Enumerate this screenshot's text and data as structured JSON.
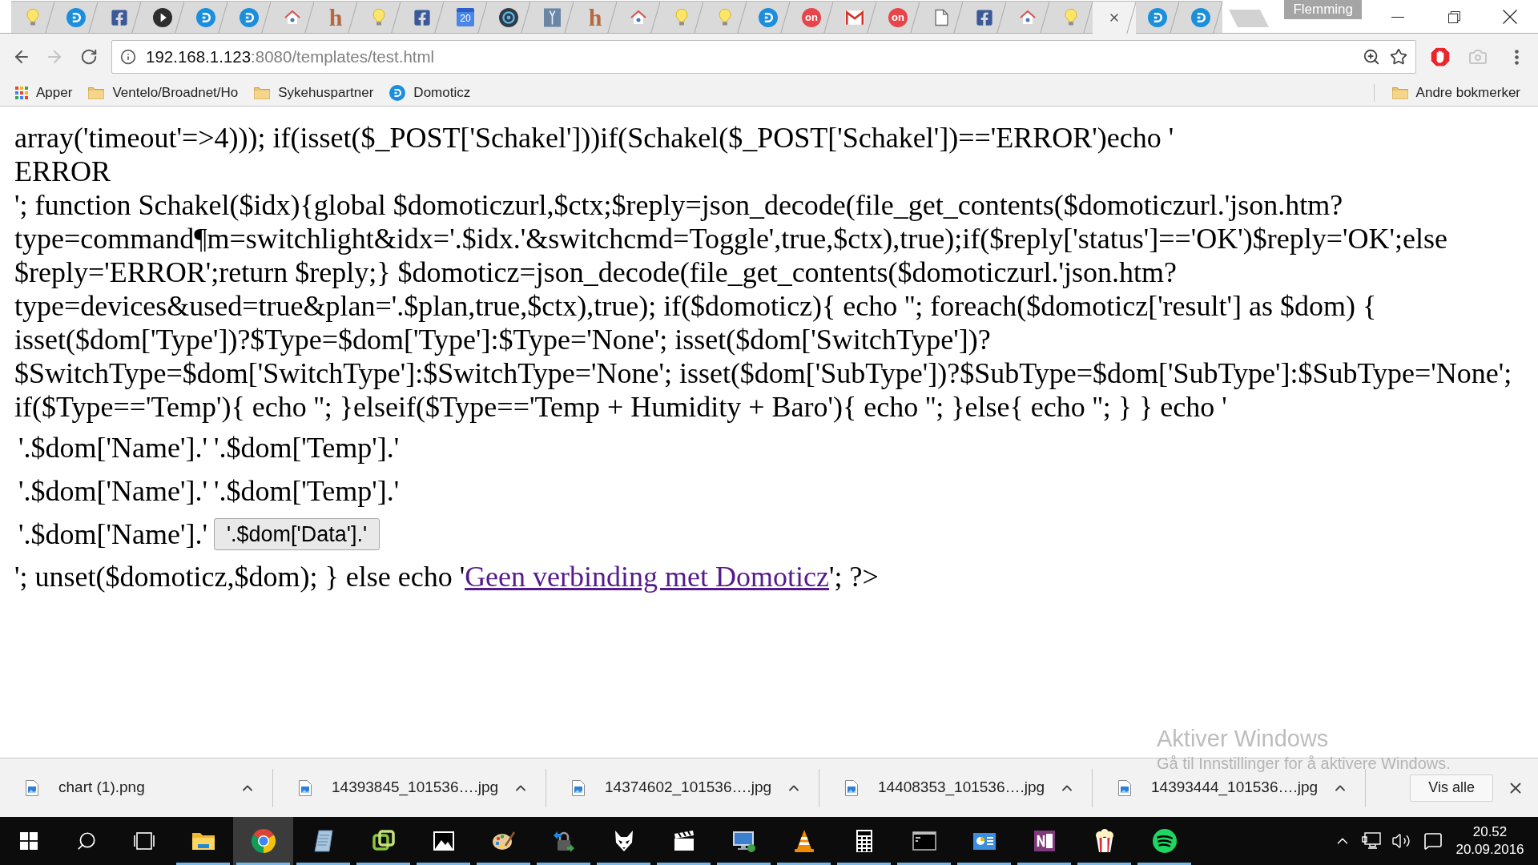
{
  "window": {
    "profile": "Flemming"
  },
  "tabs": [
    {
      "kind": "bulb",
      "selected": false
    },
    {
      "kind": "domoticz",
      "selected": false
    },
    {
      "kind": "facebook",
      "selected": false
    },
    {
      "kind": "play",
      "selected": false
    },
    {
      "kind": "domoticz",
      "selected": false
    },
    {
      "kind": "domoticz",
      "selected": false
    },
    {
      "kind": "home",
      "selected": false
    },
    {
      "kind": "letter",
      "label": "h",
      "selected": false
    },
    {
      "kind": "bulb",
      "selected": false
    },
    {
      "kind": "facebook",
      "selected": false
    },
    {
      "kind": "calendar",
      "label": "20",
      "selected": false
    },
    {
      "kind": "target",
      "selected": false
    },
    {
      "kind": "figure",
      "selected": false
    },
    {
      "kind": "letter",
      "label": "h",
      "selected": false
    },
    {
      "kind": "home",
      "selected": false
    },
    {
      "kind": "bulb",
      "selected": false
    },
    {
      "kind": "bulb",
      "selected": false
    },
    {
      "kind": "domoticz",
      "selected": false
    },
    {
      "kind": "round-label",
      "label": "on",
      "selected": false
    },
    {
      "kind": "gmail",
      "selected": false
    },
    {
      "kind": "round-label",
      "label": "on",
      "selected": false
    },
    {
      "kind": "page",
      "selected": false
    },
    {
      "kind": "facebook",
      "selected": false
    },
    {
      "kind": "home",
      "selected": false
    },
    {
      "kind": "bulb",
      "selected": false
    },
    {
      "kind": "close",
      "selected": true
    },
    {
      "kind": "domoticz",
      "selected": false
    },
    {
      "kind": "domoticz",
      "selected": false
    }
  ],
  "toolbar": {
    "forward": {
      "disabled": true
    },
    "url": {
      "host": "192.168.1.123",
      "rest": ":8080/templates/test.html"
    }
  },
  "bookmarks": {
    "items": [
      {
        "kind": "apps",
        "label": "Apper"
      },
      {
        "kind": "folder",
        "label": "Ventelo/Broadnet/Ho"
      },
      {
        "kind": "folder",
        "label": "Sykehuspartner"
      },
      {
        "kind": "domoticz",
        "label": "Domoticz"
      }
    ],
    "other": {
      "label": "Andre bokmerker"
    }
  },
  "page": {
    "lines": [
      "array('timeout'=>4))); if(isset($_POST['Schakel']))if(Schakel($_POST['Schakel'])=='ERROR')echo '",
      "ERROR",
      "'; function Schakel($idx){global $domoticzurl,$ctx;$reply=json_decode(file_get_contents($domoticzurl.'json.htm?",
      "type=command¶m=switchlight&idx='.$idx.'&switchcmd=Toggle',true,$ctx),true);if($reply['status']=='OK')$reply='OK';else",
      "$reply='ERROR';return $reply;} $domoticz=json_decode(file_get_contents($domoticzurl.'json.htm?",
      "type=devices&used=true&plan='.$plan,true,$ctx),true); if($domoticz){ echo ''; foreach($domoticz['result'] as $dom) {",
      "isset($dom['Type'])?$Type=$dom['Type']:$Type='None'; isset($dom['SwitchType'])?",
      "$SwitchType=$dom['SwitchType']:$SwitchType='None'; isset($dom['SubType'])?$SubType=$dom['SubType']:$SubType='None';",
      "if($Type=='Temp'){ echo ''; }elseif($Type=='Temp + Humidity + Baro'){ echo ''; }else{ echo ''; } } echo '"
    ],
    "rows": [
      {
        "kind": "text",
        "name": "'.$dom['Name'].'",
        "value": "'.$dom['Temp'].'"
      },
      {
        "kind": "text",
        "name": "'.$dom['Name'].'",
        "value": "'.$dom['Temp'].'"
      },
      {
        "kind": "button",
        "name": "'.$dom['Name'].'",
        "value": "'.$dom['Data'].'"
      }
    ],
    "footer": {
      "before": "'; unset($domoticz,$dom); } else echo '",
      "link": "Geen verbinding met Domoticz",
      "after": "'; ?>"
    }
  },
  "activation_notice": {
    "title": "Aktiver Windows",
    "text": "Gå til Innstillinger for å aktivere Windows."
  },
  "downloads": {
    "items": [
      {
        "file": "chart (1).png"
      },
      {
        "file": "14393845_101536….jpg"
      },
      {
        "file": "14374602_101536….jpg"
      },
      {
        "file": "14408353_101536….jpg"
      },
      {
        "file": "14393444_101536….jpg"
      }
    ],
    "show_all": "Vis alle"
  },
  "taskbar": {
    "apps": [
      {
        "kind": "folder",
        "selected": false,
        "running": true
      },
      {
        "kind": "chrome",
        "selected": true,
        "running": true
      },
      {
        "kind": "notepad",
        "selected": false,
        "running": true
      },
      {
        "kind": "squares",
        "selected": false,
        "running": true
      },
      {
        "kind": "photos",
        "selected": false,
        "running": true
      },
      {
        "kind": "palette",
        "selected": false,
        "running": true
      },
      {
        "kind": "lock",
        "selected": false,
        "running": true
      },
      {
        "kind": "fox",
        "selected": false,
        "running": true
      },
      {
        "kind": "clapper",
        "selected": false,
        "running": true
      },
      {
        "kind": "remote",
        "selected": false,
        "running": true
      },
      {
        "kind": "cone",
        "selected": false,
        "running": true
      },
      {
        "kind": "calculator",
        "selected": false,
        "running": true
      },
      {
        "kind": "terminal",
        "selected": false,
        "running": true
      },
      {
        "kind": "panel",
        "selected": false,
        "running": true
      },
      {
        "kind": "notebook",
        "selected": false,
        "running": true
      },
      {
        "kind": "popcorn",
        "selected": false,
        "running": true
      },
      {
        "kind": "spotify",
        "selected": false,
        "running": true
      }
    ],
    "clock": {
      "time": "20.52",
      "date": "20.09.2016"
    }
  }
}
